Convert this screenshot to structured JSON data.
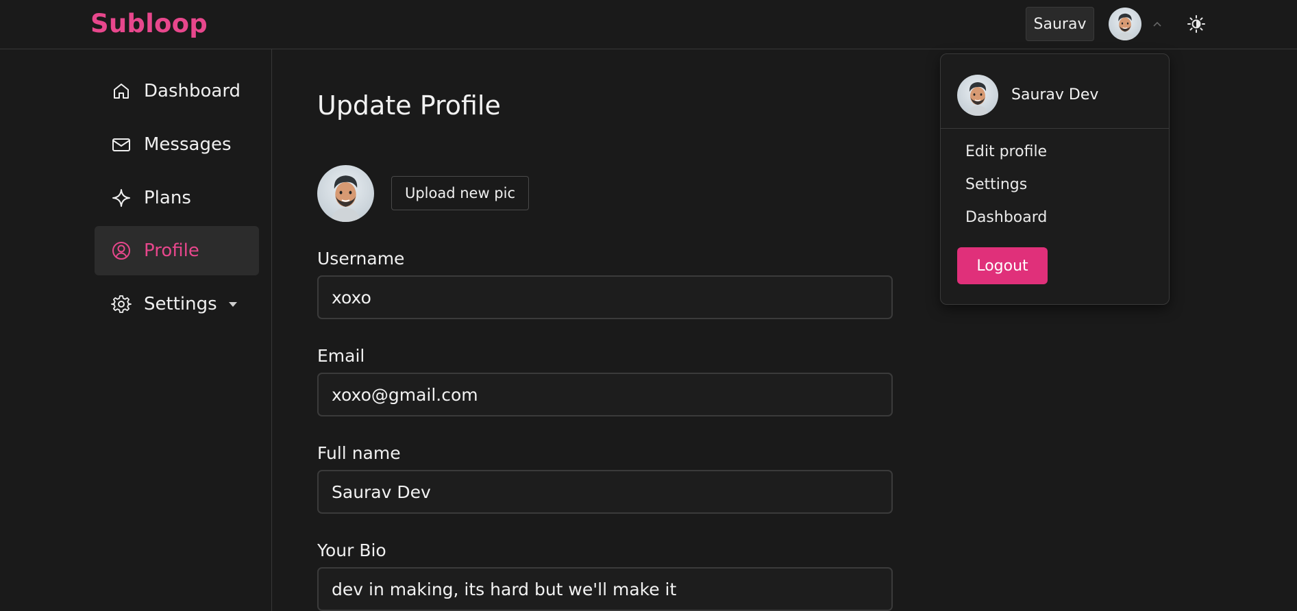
{
  "brand": {
    "name": "Subloop",
    "accent_color": "#e7478c"
  },
  "header": {
    "user_chip": "Saurav",
    "avatar_icon": "memoji-avatar",
    "chevron_icon": "chevron-up-icon",
    "theme_icon": "sun-moon-icon"
  },
  "sidebar": {
    "items": [
      {
        "label": "Dashboard",
        "icon": "home-icon",
        "active": false
      },
      {
        "label": "Messages",
        "icon": "mail-icon",
        "active": false
      },
      {
        "label": "Plans",
        "icon": "sparkle-icon",
        "active": false
      },
      {
        "label": "Profile",
        "icon": "user-circle-icon",
        "active": true
      },
      {
        "label": "Settings",
        "icon": "gear-icon",
        "active": false,
        "has_caret": true
      }
    ]
  },
  "main": {
    "title": "Update Profile",
    "upload_button": "Upload new pic",
    "fields": {
      "username": {
        "label": "Username",
        "value": "xoxo"
      },
      "email": {
        "label": "Email",
        "value": "xoxo@gmail.com"
      },
      "fullname": {
        "label": "Full name",
        "value": "Saurav Dev"
      },
      "bio": {
        "label": "Your Bio",
        "value": "dev in making, its hard but we'll make it"
      }
    }
  },
  "dropdown": {
    "name": "Saurav Dev",
    "items": [
      "Edit profile",
      "Settings",
      "Dashboard"
    ],
    "logout": "Logout",
    "logout_color": "#e0307a"
  }
}
